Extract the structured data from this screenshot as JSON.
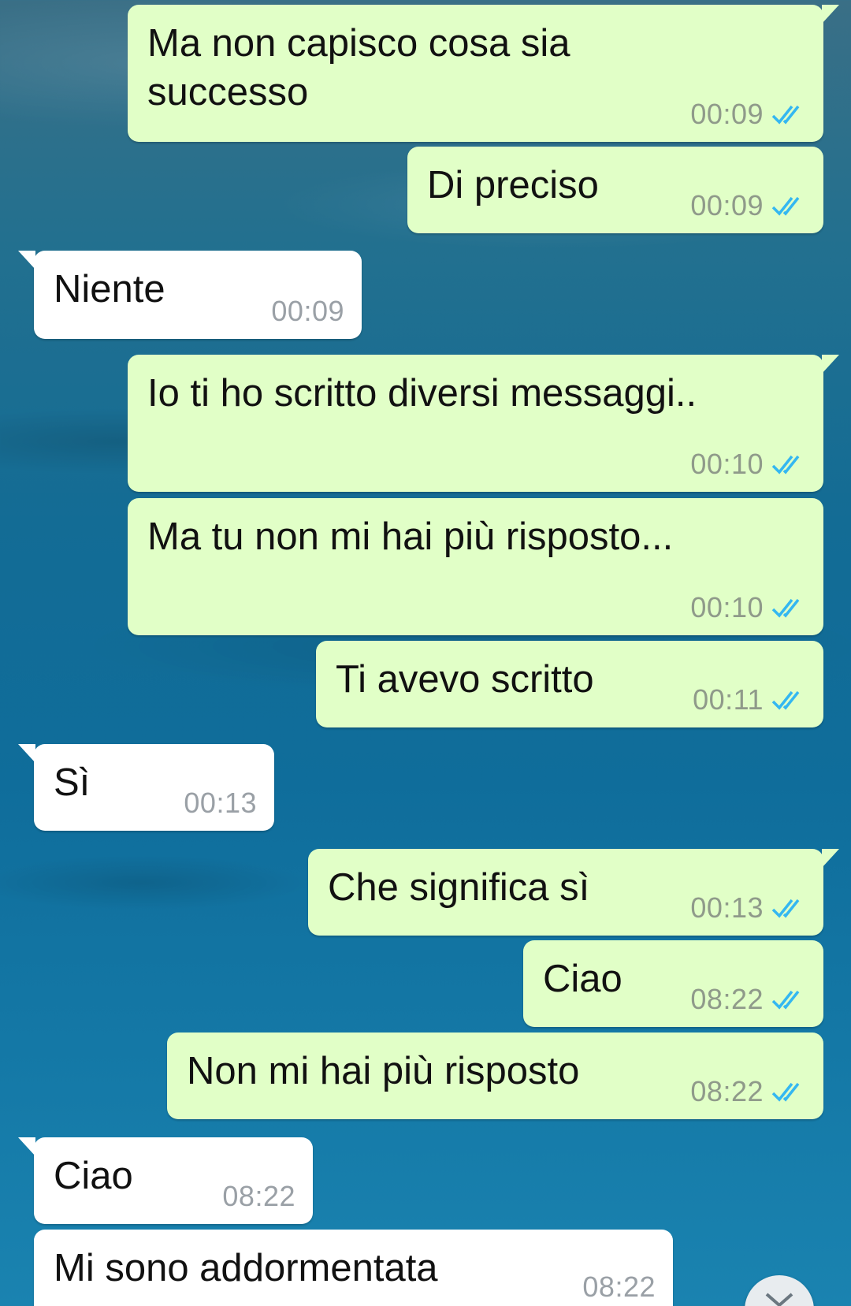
{
  "messages": [
    {
      "direction": "out",
      "text": "Ma non capisco cosa sia\nsuccesso",
      "time": "00:09",
      "status": "read"
    },
    {
      "direction": "out",
      "text": "Di preciso",
      "time": "00:09",
      "status": "read"
    },
    {
      "direction": "in",
      "text": "Niente",
      "time": "00:09"
    },
    {
      "direction": "out",
      "text": "Io ti ho scritto diversi messaggi..",
      "time": "00:10",
      "status": "read"
    },
    {
      "direction": "out",
      "text": "Ma tu non mi hai più risposto...",
      "time": "00:10",
      "status": "read"
    },
    {
      "direction": "out",
      "text": "Ti avevo scritto",
      "time": "00:11",
      "status": "read"
    },
    {
      "direction": "in",
      "text": "Sì",
      "time": "00:13"
    },
    {
      "direction": "out",
      "text": "Che significa sì",
      "time": "00:13",
      "status": "read"
    },
    {
      "direction": "out",
      "text": "Ciao",
      "time": "08:22",
      "status": "read"
    },
    {
      "direction": "out",
      "text": "Non mi hai più risposto",
      "time": "08:22",
      "status": "read"
    },
    {
      "direction": "in",
      "text": "Ciao",
      "time": "08:22"
    },
    {
      "direction": "in",
      "text": "Mi sono addormentata",
      "time": "08:22"
    }
  ],
  "colors": {
    "outgoing_bubble": "#e1ffc7",
    "incoming_bubble": "#ffffff",
    "read_ticks": "#34b7f1"
  },
  "icons": {
    "read_receipt": "double-check-icon",
    "scroll_down": "chevron-down-icon"
  }
}
